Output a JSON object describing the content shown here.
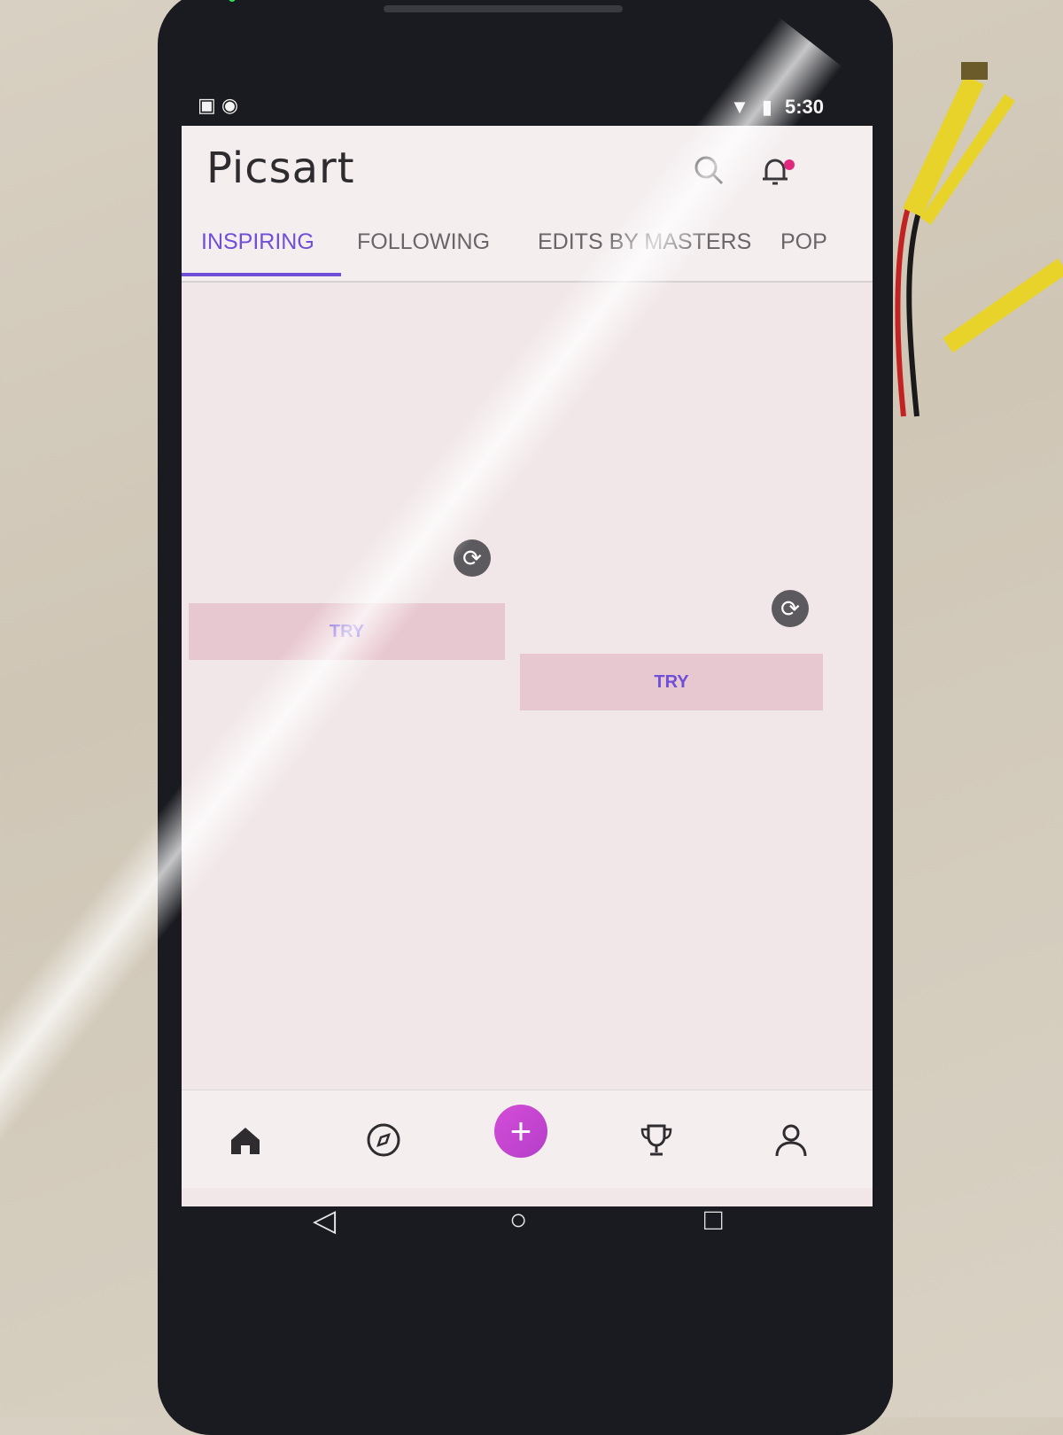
{
  "status_bar": {
    "time": "5:30",
    "left_icons": [
      "puzzle-icon",
      "record-icon"
    ],
    "right_icons": [
      "wifi-icon",
      "battery-icon"
    ]
  },
  "app": {
    "logo_text": "Picsart",
    "accent_color": "#6f4fd8",
    "notification_dot_color": "#e0297e"
  },
  "tabs": [
    {
      "label": "INSPIRING",
      "active": true
    },
    {
      "label": "FOLLOWING",
      "active": false
    },
    {
      "label": "EDITS BY MASTERS",
      "active": false
    },
    {
      "label": "POP",
      "active": false
    }
  ],
  "feed": {
    "cards": [
      {
        "button_label": "TRY"
      },
      {
        "button_label": "TRY"
      }
    ]
  },
  "bottom_nav": {
    "items": [
      "home-icon",
      "compass-icon",
      "plus-icon",
      "trophy-icon",
      "profile-icon"
    ]
  },
  "system_nav": {
    "items": [
      "back-icon",
      "home-circle-icon",
      "recents-icon"
    ]
  }
}
